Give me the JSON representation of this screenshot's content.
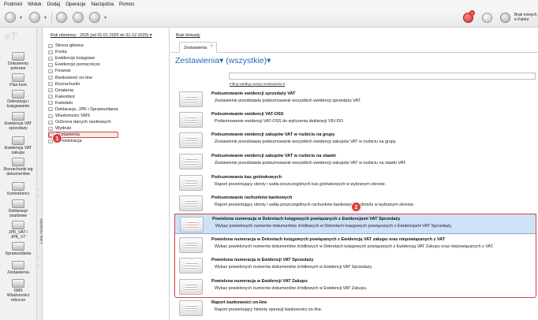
{
  "menu": [
    "Podmiot",
    "Widok",
    "Dodaj",
    "Operacje",
    "Narzędzia",
    "Pomoc"
  ],
  "toolbar": {
    "notifications_count": "5",
    "nowe_label_line1": "Brak nowych",
    "nowe_label_line2": "e-Faktur"
  },
  "modules": [
    {
      "label": "Dokumenty\npobrane"
    },
    {
      "label": "Plan kont"
    },
    {
      "label": "Dekretacja i\nksięgowanie"
    },
    {
      "label": "Ewidencja VAT\nsprzedaży"
    },
    {
      "label": "Ewidencja VAT\nzakupu"
    },
    {
      "label": "Rozrachunki wg\ndokumentów"
    },
    {
      "label": "Kontrahenci"
    },
    {
      "label": "Deklaracje\nskarbowe"
    },
    {
      "label": "JPK_VAT i\nJPK_V7"
    },
    {
      "label": "Sprawozdania"
    },
    {
      "label": "Zestawienia"
    },
    {
      "label": "SMS\nWiadomości\nroboczе"
    }
  ],
  "module_tab_label": "Lista modułów",
  "fiscal_year": "Rok obrotowy - 2025 (od 01-01-2025 do 31-12-2025)",
  "tree": [
    "Strona główna",
    "Konta",
    "Ewidencje księgowe",
    "Ewidencje pomocnicze",
    "Finanse",
    "Bankowość on-line",
    "Rozrachunki",
    "Działania",
    "Kalendarz",
    "Kartoteki",
    "Deklaracje, JPK i Sprawozdania",
    "Wiadomości SMS",
    "Ochrona danych osobowych",
    "Wydruki",
    "Zestawienia",
    "Administracja"
  ],
  "brak_blokady": "Brak blokady",
  "tab_label": "Zestawienia",
  "heading": "Zestawienia▾ (wszystkie)▾",
  "filter_label": "Filtruj według nazwy zestawienia ▾",
  "rows": [
    {
      "title": "Podsumowanie ewidencji sprzedaży VAT",
      "desc": "Zestawienie przedstawia podsumowanie wszystkich ewidencji sprzedaży VAT."
    },
    {
      "title": "Podsumowanie ewidencji VAT-OSS",
      "desc": "Podsumowanie ewidencji VAT-OSS do wyliczenia deklaracji VIU-DO"
    },
    {
      "title": "Podsumowanie ewidencji zakupów VAT w rozbiciu na grupy",
      "desc": "Zestawienie przedstawia podsumowanie wszystkich ewidencji zakupów VAT w rozbiciu na grupy."
    },
    {
      "title": "Podsumowanie ewidencji zakupów VAT w rozbiciu na stawki",
      "desc": "Zestawienie przedstawia podsumowanie wszystkich ewidencji zakupów VAT w rozbiciu na stawki VAT."
    },
    {
      "title": "Podsumowanie kas gotówkowych",
      "desc": "Raport prezentujący obroty i salda poszczególnych kas gotówkowych w wybranym okresie."
    },
    {
      "title": "Podsumowanie rachunków bankowych",
      "desc": "Raport prezentujący obroty i salda poszczególnych rachunków bankowych podmiotu w wybranym okresie."
    },
    {
      "title": "Powielona numeracja w Dekretach księgowych powiązanych z Ewidencjami VAT Sprzedaży",
      "desc": "Wykaz powielonych numerów dokumentów źródłowych w Dekretach księgowych powiązanych z Ewidencjami VAT Sprzedaży."
    },
    {
      "title": "Powielona numeracja w Dekretach księgowych powiązanych z Ewidencją VAT zakupu oraz niepowiązanych z VAT",
      "desc": "Wykaz powielonych numerów dokumentów źródłowych w Dekretach księgowych powiązanych z Ewidencją VAT Zakupu oraz niepowiązanych z VAT."
    },
    {
      "title": "Powielona numeracja w Ewidencji VAT Sprzedaży",
      "desc": "Wykaz powielonych numerów dokumentów źródłowych w Ewidencji VAT Sprzedaży."
    },
    {
      "title": "Powielona numeracja w Ewidencji VAT Zakupu",
      "desc": "Wykaz powielonych numerów dokumentów źródłowych w Ewidencji VAT Zakupu."
    },
    {
      "title": "Raport bankowości on-line",
      "desc": "Raport prezentujący historię operacji bankowości on-line."
    }
  ],
  "markers": [
    "1",
    "2"
  ],
  "colors": {
    "accent": "#2a64b8",
    "highlight": "#d94040",
    "selection": "#cfe1f5"
  }
}
